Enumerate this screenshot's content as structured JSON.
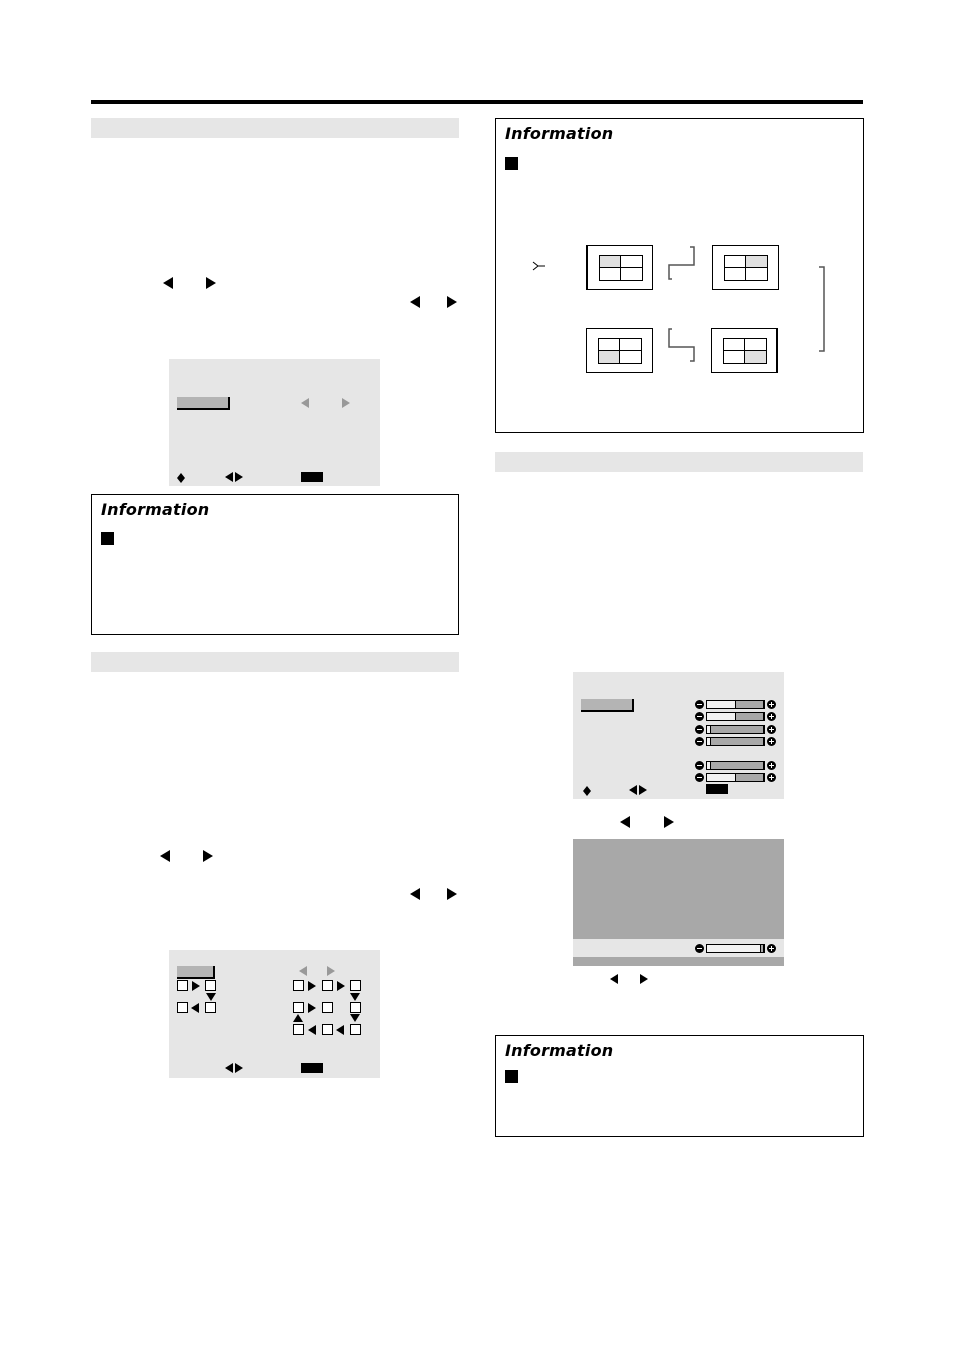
{
  "page": {
    "sections": [
      {
        "id": "section-1",
        "heading": ""
      },
      {
        "id": "section-2",
        "heading": ""
      },
      {
        "id": "section-3",
        "heading": ""
      }
    ]
  },
  "info_boxes": [
    {
      "title": "Information"
    },
    {
      "title": "Information"
    },
    {
      "title": "Information"
    }
  ],
  "icons": {
    "left_arrow": "left-triangle",
    "right_arrow": "right-triangle",
    "up_down": "up-down-arrows",
    "exit": "exit-button",
    "bullet": "black-square"
  },
  "menu_settings": {
    "sliders": [
      {
        "value_fraction": 0.5
      },
      {
        "value_fraction": 0.5
      },
      {
        "value_fraction": 0.05
      },
      {
        "value_fraction": 0.05
      },
      {
        "value_fraction": 0.05
      },
      {
        "value_fraction": 0.5
      }
    ]
  },
  "adjust_panel": {
    "slider": {
      "value_fraction": 0.95
    }
  },
  "multiscreen_diagram": {
    "screens": [
      {
        "position": "top-left",
        "highlighted_cell": "top-left"
      },
      {
        "position": "top-right",
        "highlighted_cell": "top-right"
      },
      {
        "position": "bottom-right",
        "highlighted_cell": "bottom-right"
      },
      {
        "position": "bottom-left",
        "highlighted_cell": "bottom-left"
      }
    ]
  },
  "colors": {
    "section_bar": "#e6e6e6",
    "menu_background": "#e6e6e6",
    "menu_selection": "#b4b4b4",
    "adjust_panel": "#a8a8a8",
    "highlight_cell": "#e0e0e0"
  }
}
